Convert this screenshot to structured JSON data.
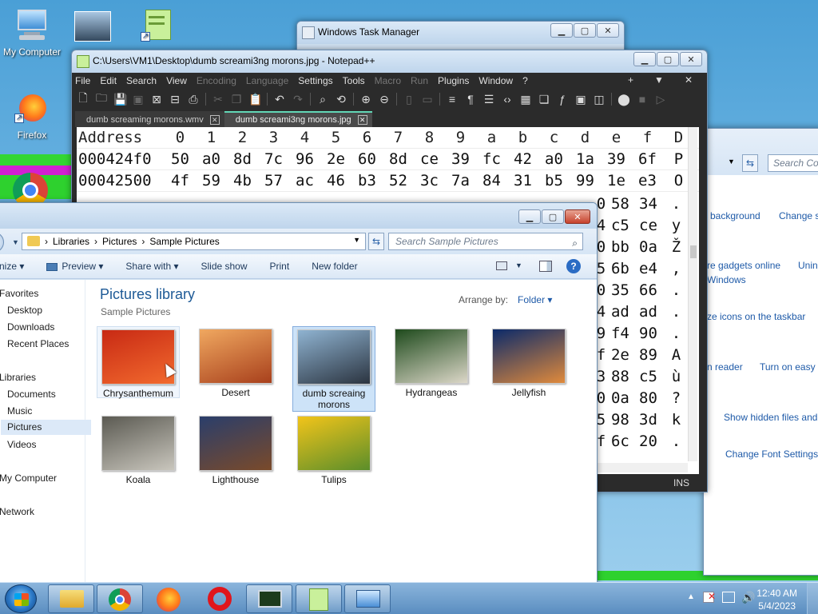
{
  "desktop": {
    "icons": [
      {
        "label": "My Computer"
      },
      {
        "label": ""
      },
      {
        "label": ""
      },
      {
        "label": "Firefox"
      }
    ]
  },
  "task_manager": {
    "title": "Windows Task Manager"
  },
  "notepad": {
    "title": "C:\\Users\\VM1\\Desktop\\dumb screami3ng morons.jpg - Notepad++",
    "menu": [
      "File",
      "Edit",
      "Search",
      "View",
      "Encoding",
      "Language",
      "Settings",
      "Tools",
      "Macro",
      "Run",
      "Plugins",
      "Window",
      "?"
    ],
    "menu_right": [
      "+",
      "▼",
      "✕"
    ],
    "tabs": [
      {
        "label": "dumb screaming morons.wmv"
      },
      {
        "label": "dumb screami3ng morons.jpg"
      }
    ],
    "hex_header": [
      "Address",
      "0",
      "1",
      "2",
      "3",
      "4",
      "5",
      "6",
      "7",
      "8",
      "9",
      "a",
      "b",
      "c",
      "d",
      "e",
      "f",
      "D"
    ],
    "hex_rows": [
      [
        "000424f0",
        "50",
        "a0",
        "8d",
        "7c",
        "96",
        "2e",
        "60",
        "8d",
        "ce",
        "39",
        "fc",
        "42",
        "a0",
        "1a",
        "39",
        "6f",
        "P"
      ],
      [
        "00042500",
        "4f",
        "59",
        "4b",
        "57",
        "ac",
        "46",
        "b3",
        "52",
        "3c",
        "7a",
        "84",
        "31",
        "b5",
        "99",
        "1e",
        "e3",
        "O"
      ]
    ],
    "hex_right_cols": [
      [
        "0",
        "58",
        "34",
        "."
      ],
      [
        "4",
        "c5",
        "ce",
        "y"
      ],
      [
        "0",
        "bb",
        "0a",
        "Ž"
      ],
      [
        "5",
        "6b",
        "e4",
        ","
      ],
      [
        "0",
        "35",
        "66",
        "."
      ],
      [
        "4",
        "ad",
        "ad",
        "."
      ],
      [
        "9",
        "f4",
        "90",
        "."
      ],
      [
        "f",
        "2e",
        "89",
        "A"
      ],
      [
        "3",
        "88",
        "c5",
        "ù"
      ],
      [
        "0",
        "0a",
        "80",
        "?"
      ],
      [
        "5",
        "98",
        "3d",
        "k"
      ],
      [
        "f",
        "6c",
        "20",
        "."
      ]
    ],
    "status_ins": "INS"
  },
  "explorer": {
    "breadcrumb": [
      "Libraries",
      "Pictures",
      "Sample Pictures"
    ],
    "search_placeholder": "Search Sample Pictures",
    "commands": [
      "nize ▾",
      "Preview ▾",
      "Share with ▾",
      "Slide show",
      "Print",
      "New folder"
    ],
    "nav": [
      "Favorites",
      "Desktop",
      "Downloads",
      "Recent Places",
      "Libraries",
      "Documents",
      "Music",
      "Pictures",
      "Videos",
      "My Computer",
      "Network"
    ],
    "library_title": "Pictures library",
    "library_subtitle": "Sample Pictures",
    "arrange_label": "Arrange by:",
    "arrange_value": "Folder ▾",
    "pictures": [
      {
        "label": "Chrysanthemum",
        "color1": "#c82a14",
        "color2": "#f26a2e"
      },
      {
        "label": "Desert",
        "color1": "#f0a860",
        "color2": "#a8401c"
      },
      {
        "label": "dumb screaing morons",
        "color1": "#8fb3d1",
        "color2": "#2b3440"
      },
      {
        "label": "Hydrangeas",
        "color1": "#1e4a1c",
        "color2": "#dcd7c8"
      },
      {
        "label": "Jellyfish",
        "color1": "#0b2a6a",
        "color2": "#e08a3c"
      },
      {
        "label": "Koala",
        "color1": "#5b5a52",
        "color2": "#c9c6bd"
      },
      {
        "label": "Lighthouse",
        "color1": "#2a3e6b",
        "color2": "#7a4a2a"
      },
      {
        "label": "Tulips",
        "color1": "#f2c41a",
        "color2": "#5b8e2a"
      }
    ]
  },
  "control_panel": {
    "search_placeholder": "Search Con",
    "links": [
      "background",
      "Change s",
      "re gadgets online",
      "Unin",
      "Windows",
      "ze icons on the taskbar",
      "n reader",
      "Turn on easy a",
      "Show hidden files and",
      "Change Font Settings"
    ]
  },
  "taskbar": {
    "clock_time": "12:40 AM",
    "clock_date": "5/4/2023"
  }
}
